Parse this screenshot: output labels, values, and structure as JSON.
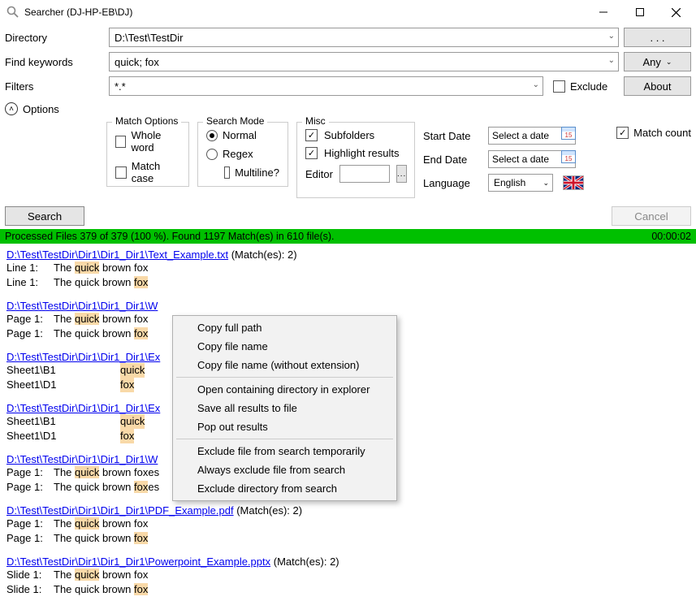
{
  "window": {
    "title": "Searcher (DJ-HP-EB\\DJ)"
  },
  "form": {
    "directory_label": "Directory",
    "directory_value": "D:\\Test\\TestDir",
    "keywords_label": "Find keywords",
    "keywords_value": "quick; fox",
    "filters_label": "Filters",
    "filters_value": "*.*",
    "browse_label": ". . .",
    "any_label": "Any",
    "about_label": "About",
    "exclude_label": "Exclude",
    "options_label": "Options"
  },
  "groups": {
    "match_options": {
      "title": "Match Options",
      "whole_word": "Whole word",
      "match_case": "Match case"
    },
    "search_mode": {
      "title": "Search Mode",
      "normal": "Normal",
      "regex": "Regex",
      "multiline": "Multiline?"
    },
    "misc": {
      "title": "Misc",
      "subfolders": "Subfolders",
      "highlight": "Highlight results",
      "editor": "Editor",
      "browse": "..."
    },
    "dates": {
      "start": "Start Date",
      "end": "End Date",
      "placeholder": "Select a date",
      "cal_num": "15",
      "language_label": "Language",
      "language_value": "English"
    },
    "match_count": "Match count"
  },
  "actions": {
    "search": "Search",
    "cancel": "Cancel"
  },
  "status": {
    "left": "Processed Files 379 of 379 (100 %).   Found 1197 Match(es) in 610 file(s).",
    "right": "00:00:02"
  },
  "results": [
    {
      "path": "D:\\Test\\TestDir\\Dir1\\Dir1_Dir1\\Text_Example.txt",
      "match_text": " (Match(es): 2)",
      "lines": [
        {
          "loc": "Line 1:",
          "pre": "The ",
          "hl": "quick",
          "post": " brown fox"
        },
        {
          "loc": "Line 1:",
          "pre": "The quick brown ",
          "hl": "fox",
          "post": ""
        }
      ]
    },
    {
      "path": "D:\\Test\\TestDir\\Dir1\\Dir1_Dir1\\W",
      "match_text": "",
      "lines": [
        {
          "loc": "Page 1:",
          "pre": "The ",
          "hl": "quick",
          "post": " brown fox"
        },
        {
          "loc": "Page 1:",
          "pre": "The quick brown ",
          "hl": "fox",
          "post": ""
        }
      ]
    },
    {
      "path": "D:\\Test\\TestDir\\Dir1\\Dir1_Dir1\\Ex",
      "match_text": "",
      "sheet_lines": [
        {
          "loc": "Sheet1\\B1",
          "hl": "quick"
        },
        {
          "loc": "Sheet1\\D1",
          "hl": "fox"
        }
      ]
    },
    {
      "path": "D:\\Test\\TestDir\\Dir1\\Dir1_Dir1\\Ex",
      "match_text": "",
      "sheet_lines": [
        {
          "loc": "Sheet1\\B1",
          "hl": "quick"
        },
        {
          "loc": "Sheet1\\D1",
          "hl": "fox"
        }
      ]
    },
    {
      "path": "D:\\Test\\TestDir\\Dir1\\Dir1_Dir1\\W",
      "match_text": "",
      "lines": [
        {
          "loc": "Page 1:",
          "pre": "The ",
          "hl": "quick",
          "post": " brown foxes"
        },
        {
          "loc": "Page 1:",
          "pre": "The quick brown ",
          "hl": "fox",
          "post": "es"
        }
      ]
    },
    {
      "path": "D:\\Test\\TestDir\\Dir1\\Dir1_Dir1\\PDF_Example.pdf",
      "match_text": " (Match(es): 2)",
      "lines": [
        {
          "loc": "Page 1:",
          "pre": "The ",
          "hl": "quick",
          "post": " brown fox"
        },
        {
          "loc": "Page 1:",
          "pre": "The quick brown ",
          "hl": "fox",
          "post": ""
        }
      ]
    },
    {
      "path": "D:\\Test\\TestDir\\Dir1\\Dir1_Dir1\\Powerpoint_Example.pptx",
      "match_text": " (Match(es): 2)",
      "lines": [
        {
          "loc": "Slide 1:",
          "pre": "The ",
          "hl": "quick",
          "post": " brown fox"
        },
        {
          "loc": "Slide 1:",
          "pre": "The quick brown ",
          "hl": "fox",
          "post": ""
        }
      ]
    }
  ],
  "context_menu": {
    "groups": [
      [
        "Copy full path",
        "Copy file name",
        "Copy file name (without extension)"
      ],
      [
        "Open containing directory in explorer",
        "Save all results to file",
        "Pop out results"
      ],
      [
        "Exclude file from search temporarily",
        "Always exclude file from search",
        "Exclude directory from search"
      ]
    ]
  }
}
